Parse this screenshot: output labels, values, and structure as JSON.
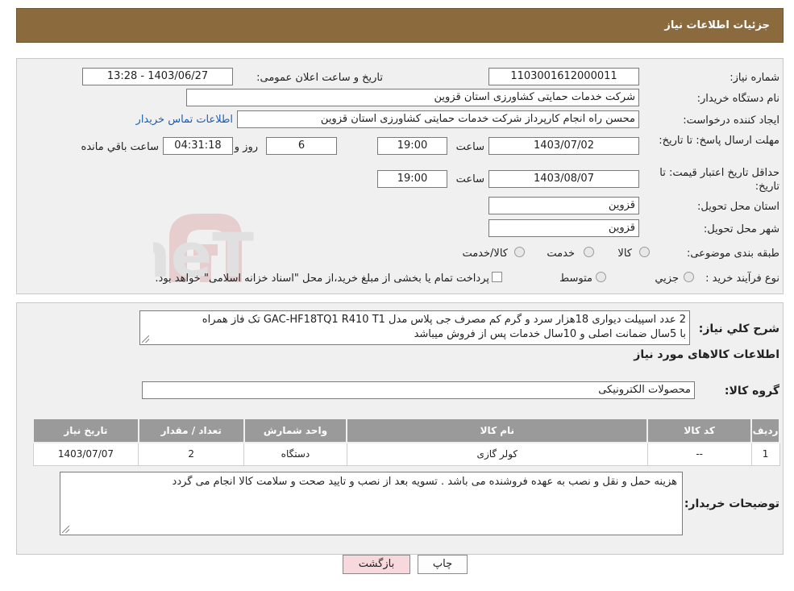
{
  "header": {
    "title": "جزئیات اطلاعات نیاز"
  },
  "form": {
    "need_number_label": "شماره نیاز:",
    "need_number": "1103001612000011",
    "announce_label": "تاریخ و ساعت اعلان عمومی:",
    "announce_value": "1403/06/27 - 13:28",
    "buyer_org_label": "نام دستگاه خریدار:",
    "buyer_org": "شرکت خدمات حمایتی کشاورزی استان قزوین",
    "creator_label": "ایجاد کننده درخواست:",
    "creator": "محسن راه انجام کارپرداز شرکت خدمات حمایتی کشاورزی استان قزوین",
    "contact_link": "اطلاعات تماس خریدار",
    "deadline_label": "مهلت ارسال پاسخ: تا تاریخ:",
    "deadline_date": "1403/07/02",
    "time_label": "ساعت",
    "deadline_time": "19:00",
    "days": "6",
    "days_label": "روز و",
    "remaining": "04:31:18",
    "remaining_label": "ساعت باقي مانده",
    "validity_label": "حداقل تاریخ اعتبار قیمت: تا تاریخ:",
    "validity_date": "1403/08/07",
    "validity_time": "19:00",
    "province_label": "استان محل تحویل:",
    "province": "قزوین",
    "city_label": "شهر محل تحویل:",
    "city": "قزوین",
    "category_label": "طبقه بندی موضوعی:",
    "category_options": [
      "کالا",
      "خدمت",
      "کالا/خدمت"
    ],
    "process_label": "نوع فرآیند خرید :",
    "process_options": [
      "جزیي",
      "متوسط"
    ],
    "process_note": "پرداخت تمام یا بخشی از مبلغ خرید،از محل \"اسناد خزانه اسلامی\" خواهد بود."
  },
  "description": {
    "label": "شرح كلي نياز:",
    "line1": "2 عدد اسپیلت دیواری 18هزار سرد و گرم کم مصرف جی پلاس مدل GAC-HF18TQ1  R410 T1 تک فاز همراه",
    "line2": "با 5سال ضمانت اصلی و 10سال خدمات پس از فروش میباشد"
  },
  "goods_section": {
    "title": "اطلاعات کالاهای مورد نیاز",
    "group_label": "گروه کالا:",
    "group_value": "محصولات الکترونیکی"
  },
  "table": {
    "headers": [
      "ردیف",
      "کد کالا",
      "نام کالا",
      "واحد شمارش",
      "تعداد / مقدار",
      "تاریخ نیاز"
    ],
    "rows": [
      [
        "1",
        "--",
        "کولر گازی",
        "دستگاه",
        "2",
        "1403/07/07"
      ]
    ]
  },
  "buyer_notes": {
    "label": "توضیحات خریدار:",
    "text": "هزینه حمل و نقل  و نصب به عهده فروشنده می باشد . تسویه بعد از نصب و تایید صحت و سلامت کالا انجام می گردد"
  },
  "buttons": {
    "print": "چاپ",
    "back": "بازگشت"
  },
  "watermark": {
    "text": "AriaTender.neT"
  },
  "colors": {
    "header": "#8b6a3e",
    "link": "#1a5fb4",
    "back_button": "#f7d9dd",
    "table_header": "#9a9a9a"
  }
}
